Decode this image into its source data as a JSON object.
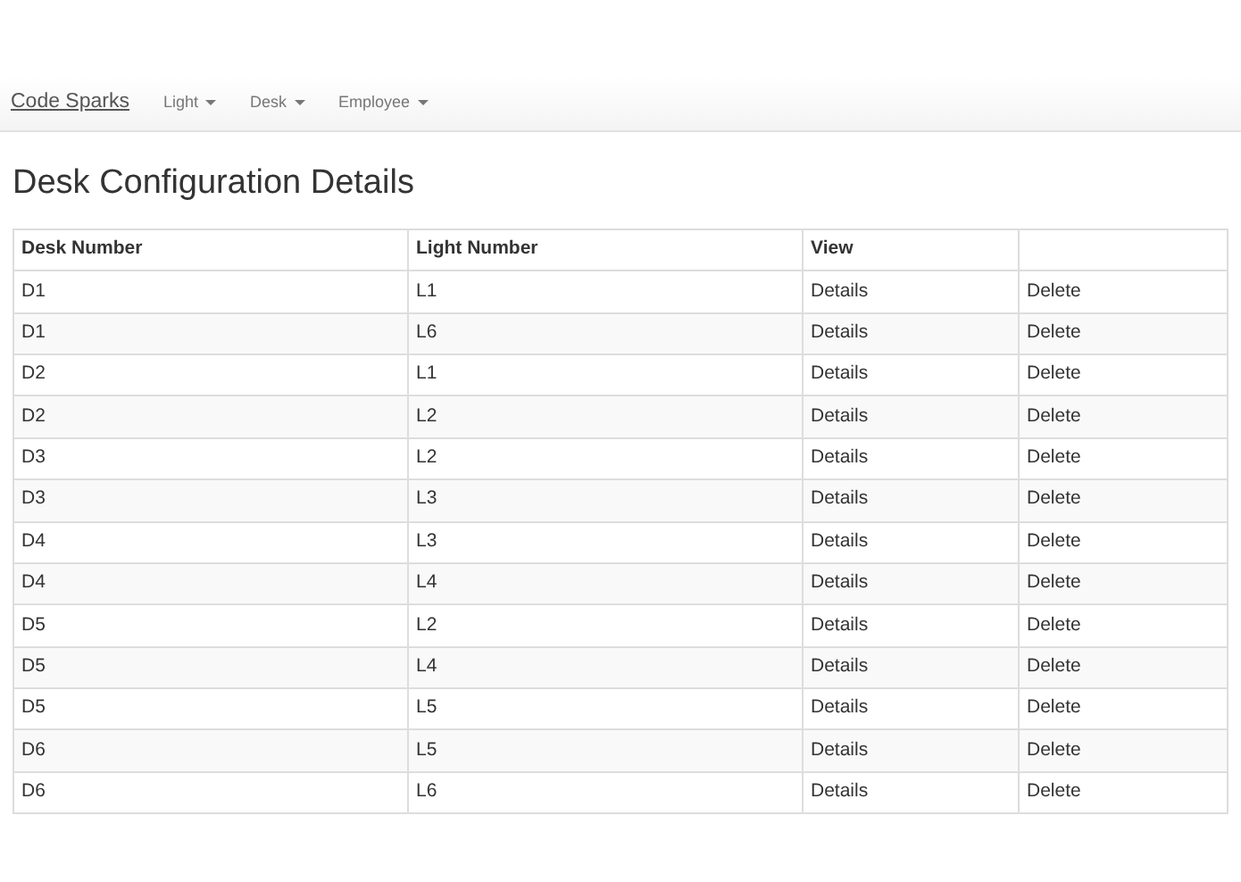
{
  "navbar": {
    "brand": "Code Sparks",
    "menus": [
      {
        "label": "Light"
      },
      {
        "label": "Desk"
      },
      {
        "label": "Employee"
      }
    ]
  },
  "heading": "Desk Configuration Details",
  "table": {
    "columns": [
      "Desk Number",
      "Light Number",
      "View"
    ],
    "rows": [
      {
        "desk": "D1",
        "light": "L1",
        "details": "Details",
        "delete": "Delete"
      },
      {
        "desk": "D1",
        "light": "L6",
        "details": "Details",
        "delete": "Delete"
      },
      {
        "desk": "D2",
        "light": "L1",
        "details": "Details",
        "delete": "Delete"
      },
      {
        "desk": "D2",
        "light": "L2",
        "details": "Details",
        "delete": "Delete"
      },
      {
        "desk": "D3",
        "light": "L2",
        "details": "Details",
        "delete": "Delete"
      },
      {
        "desk": "D3",
        "light": "L3",
        "details": "Details",
        "delete": "Delete"
      },
      {
        "desk": "D4",
        "light": "L3",
        "details": "Details",
        "delete": "Delete"
      },
      {
        "desk": "D4",
        "light": "L4",
        "details": "Details",
        "delete": "Delete"
      },
      {
        "desk": "D5",
        "light": "L2",
        "details": "Details",
        "delete": "Delete"
      },
      {
        "desk": "D5",
        "light": "L4",
        "details": "Details",
        "delete": "Delete"
      },
      {
        "desk": "D5",
        "light": "L5",
        "details": "Details",
        "delete": "Delete"
      },
      {
        "desk": "D6",
        "light": "L5",
        "details": "Details",
        "delete": "Delete"
      },
      {
        "desk": "D6",
        "light": "L6",
        "details": "Details",
        "delete": "Delete"
      }
    ]
  }
}
